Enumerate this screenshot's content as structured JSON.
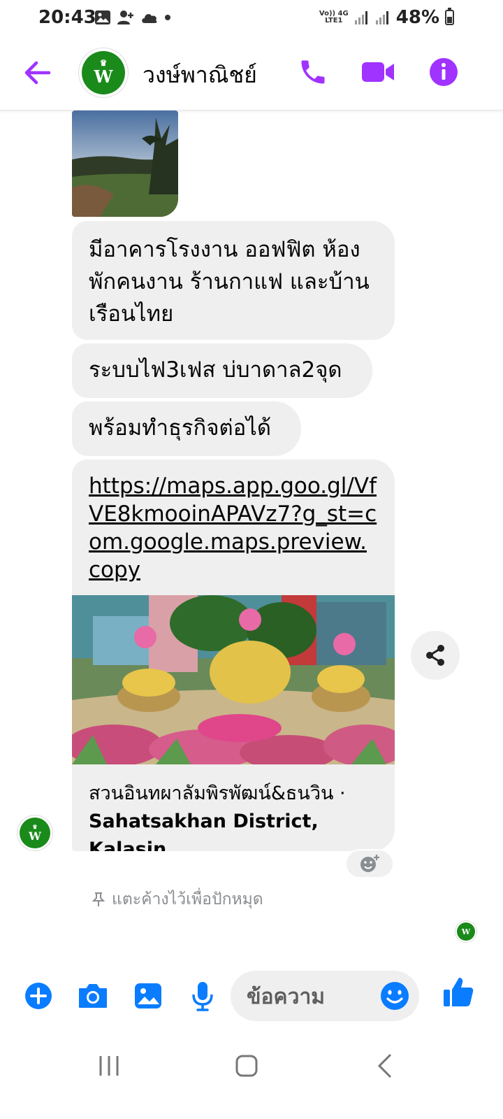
{
  "status_bar": {
    "time": "20:43",
    "network_top": "Vo)) 4G",
    "network_bottom": "LTE1",
    "battery": "48%"
  },
  "header": {
    "contact_name": "วงษ์พาณิชย์",
    "avatar_text": "W",
    "accent_color": "#a033ff"
  },
  "messages": [
    {
      "id": "m1",
      "type": "text",
      "text": "มีอาคารโรงงาน ออฟฟิต ห้องพักคนงาน ร้านกาแฟ และบ้านเรือนไทย"
    },
    {
      "id": "m2",
      "type": "text",
      "text": "ระบบไฟ3เฟส บ่บาดาล2จุด"
    },
    {
      "id": "m3",
      "type": "text",
      "text": "พร้อมทำธุรกิจต่อได้"
    }
  ],
  "link_card": {
    "url": "https://maps.app.goo.gl/VfVE8kmooinAPAVz7?g_st=com.google.maps.preview.copy",
    "place": "สวนอินทผาลัมพิรพัฒน์&ธนวิน ·",
    "district": "Sahatsakhan District, Kalasin"
  },
  "pin_hint": "แตะค้างไว้เพื่อปักหมุด",
  "composer": {
    "placeholder": "ข้อความ",
    "icon_color": "#0a7cff"
  }
}
